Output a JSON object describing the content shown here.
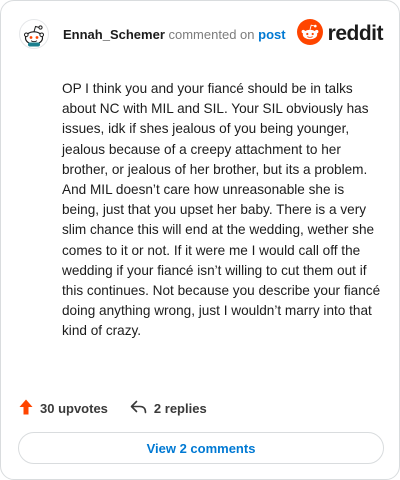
{
  "comment": {
    "username": "Ennah_Schemer",
    "commented_on": "commented on",
    "post_link": "post",
    "body": "OP I think you and your fiancé should be in talks about NC with MIL and SIL. Your SIL obviously has issues, idk if shes jealous of you being younger, jealous because of a creepy attachment to her brother, or jealous of her brother, but its a problem. And MIL doesn’t care how unreasonable she is being, just that you upset her baby. There is a very slim chance this will end at the wedding, wether she comes to it or not. If it were me I would call off the wedding if your fiancé isn’t willing to cut them out if this continues. Not because you describe your fiancé doing anything wrong, just I wouldn’t marry into that kind of crazy."
  },
  "brand": {
    "name": "reddit",
    "color": "#ff4500"
  },
  "footer": {
    "upvotes": "30 upvotes",
    "replies": "2 replies",
    "upvote_color": "#ff4500"
  },
  "view_comments": "View 2 comments",
  "icons": {
    "avatar": "snoo-avatar-icon",
    "logo": "reddit-logo-icon",
    "upvote": "upvote-arrow-icon",
    "reply": "reply-arrow-icon"
  }
}
